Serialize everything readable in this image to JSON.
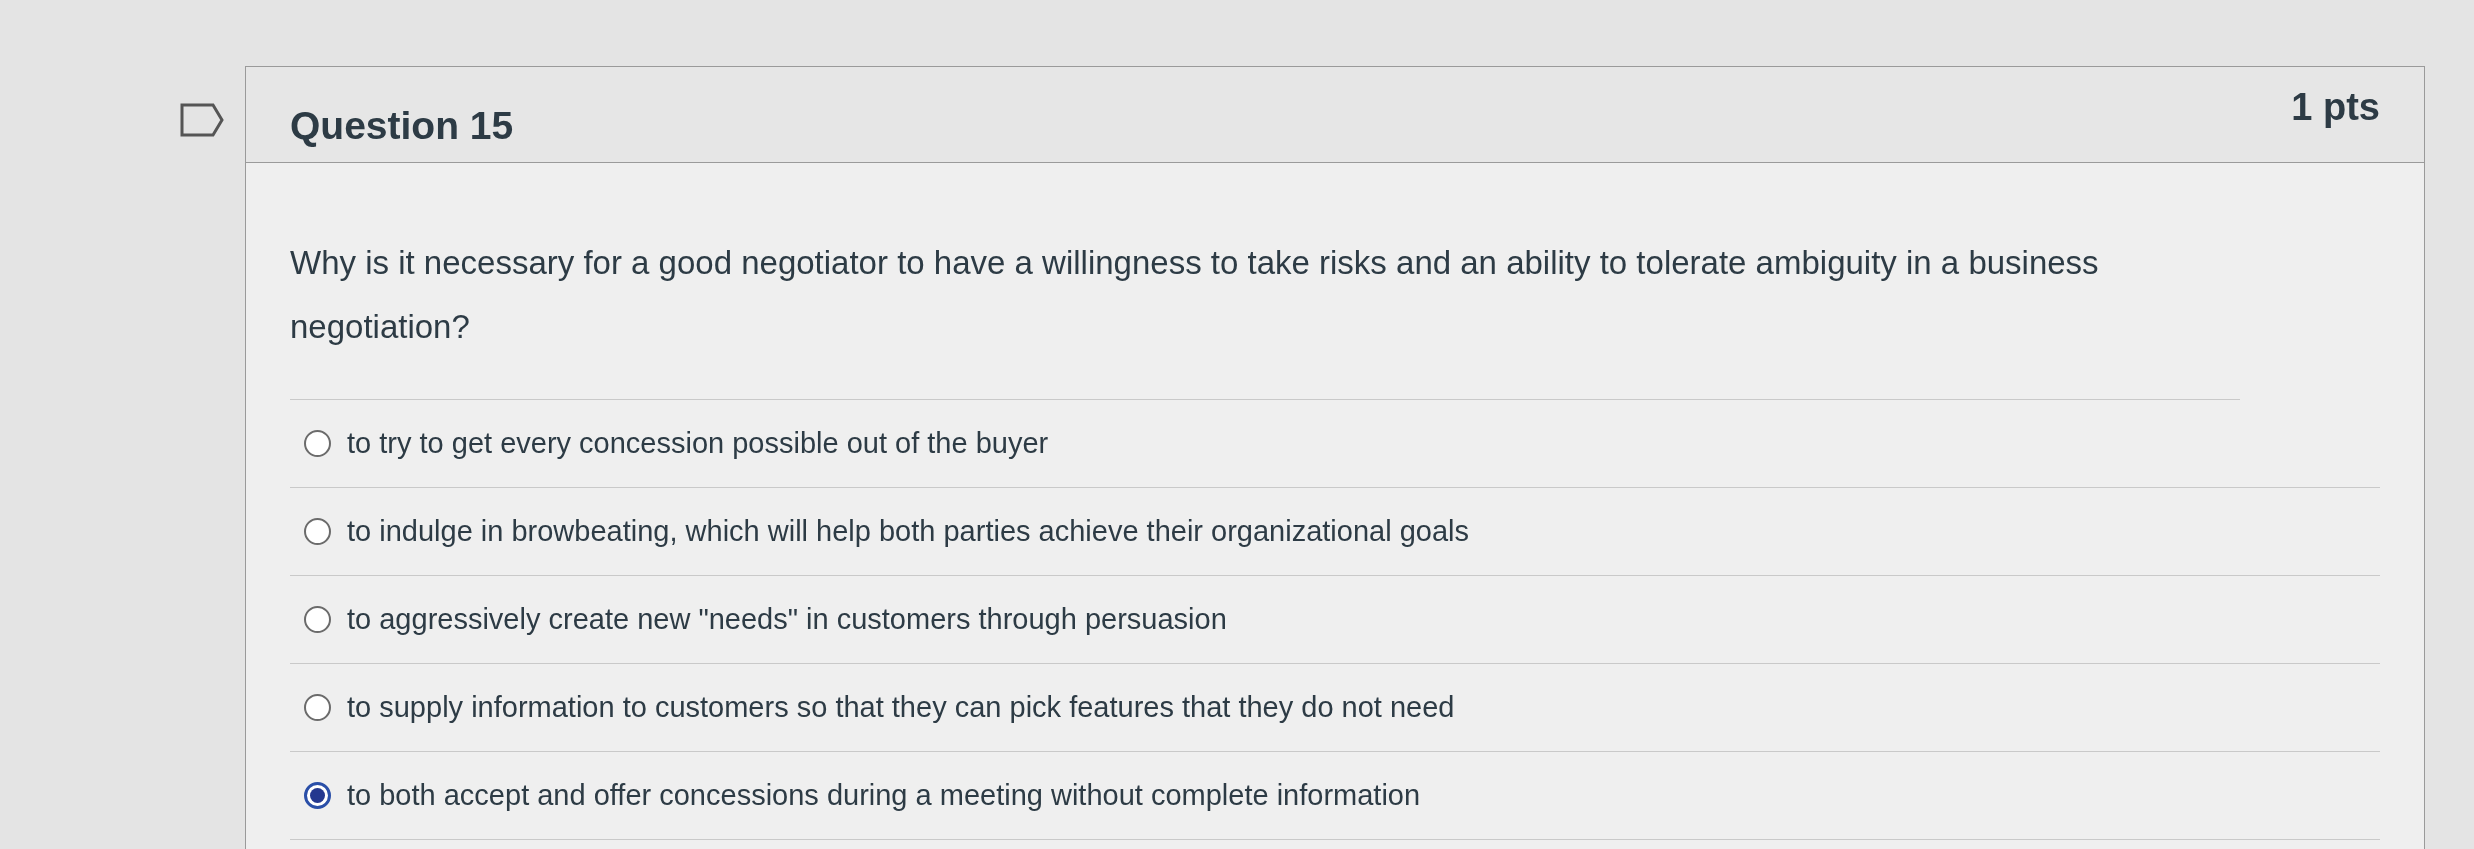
{
  "question": {
    "title": "Question 15",
    "points": "1 pts",
    "flagged": false,
    "text": "Why is it necessary for a good negotiator to have a willingness to take risks and an ability to tolerate ambiguity in a business negotiation?",
    "options": [
      {
        "label": "to try to get every concession possible out of the buyer",
        "selected": false
      },
      {
        "label": "to indulge in browbeating, which will help both parties achieve their organizational goals",
        "selected": false
      },
      {
        "label": "to aggressively create new \"needs\" in customers through persuasion",
        "selected": false
      },
      {
        "label": "to supply information to customers so that they can pick features that they do not need",
        "selected": false
      },
      {
        "label": "to both accept and offer concessions during a meeting without complete information",
        "selected": true
      }
    ]
  }
}
